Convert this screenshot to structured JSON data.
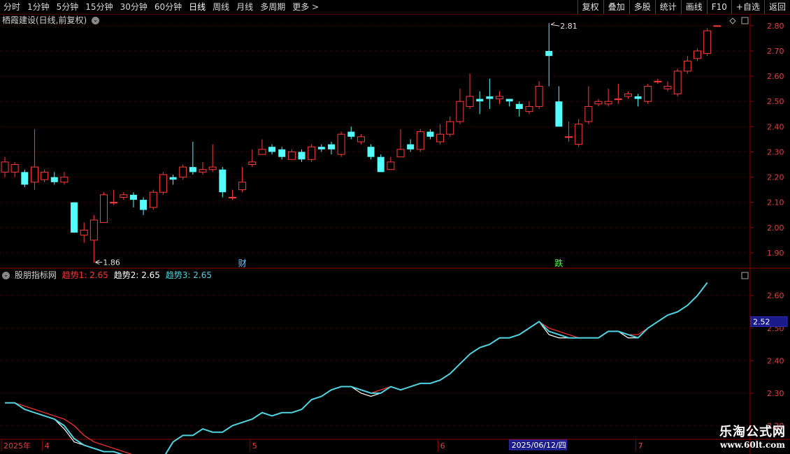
{
  "toolbar": {
    "periods": [
      "分时",
      "1分钟",
      "5分钟",
      "15分钟",
      "30分钟",
      "60分钟",
      "日线",
      "周线",
      "月线",
      "多周期",
      "更多 >"
    ],
    "active_period": "日线",
    "buttons": [
      "复权",
      "叠加",
      "多股",
      "统计",
      "画线",
      "F10",
      "+自选",
      "返回"
    ]
  },
  "main_chart": {
    "title": "栖霞建设(日线,前复权)",
    "y_ticks": [
      "2.80",
      "2.70",
      "2.60",
      "2.50",
      "2.40",
      "2.30",
      "2.20",
      "2.10",
      "2.00",
      "1.90"
    ],
    "high_label": "2.81",
    "low_label": "1.86",
    "markers": [
      {
        "text": "财",
        "color": "#6ec6ff"
      },
      {
        "text": "跌",
        "color": "#4cff4c"
      }
    ]
  },
  "indicator": {
    "name": "股朋指标网",
    "lines": [
      {
        "label": "趋势1: 2.65",
        "color": "#ff3333"
      },
      {
        "label": "趋势2: 2.65",
        "color": "#ffffff"
      },
      {
        "label": "趋势3: 2.65",
        "color": "#4fd3e0"
      }
    ],
    "y_ticks": [
      "2.60",
      "2.50",
      "2.40",
      "2.30",
      "2.20"
    ],
    "cursor_value": "2.52"
  },
  "x_axis": {
    "labels": [
      "2025年",
      "4",
      "5",
      "6",
      "7"
    ],
    "cursor_date": "2025/06/12/四"
  },
  "watermark": {
    "line1": "乐淘公式网",
    "line2": "www.60lt.com"
  },
  "chart_data": {
    "type": "candlestick",
    "candles": [
      [
        2.22,
        2.26,
        2.2,
        2.28
      ],
      [
        2.22,
        2.25,
        2.2,
        2.26
      ],
      [
        2.22,
        2.17,
        2.16,
        2.23
      ],
      [
        2.18,
        2.24,
        2.15,
        2.39
      ],
      [
        2.19,
        2.22,
        2.18,
        2.23
      ],
      [
        2.2,
        2.18,
        2.17,
        2.22
      ],
      [
        2.18,
        2.2,
        2.17,
        2.22
      ],
      [
        2.1,
        1.98,
        1.98,
        2.1
      ],
      [
        1.97,
        1.99,
        1.94,
        2.02
      ],
      [
        1.95,
        2.03,
        1.86,
        2.05
      ],
      [
        2.02,
        2.13,
        2.02,
        2.14
      ],
      [
        2.1,
        2.1,
        2.09,
        2.15
      ],
      [
        2.12,
        2.13,
        2.11,
        2.14
      ],
      [
        2.13,
        2.11,
        2.08,
        2.14
      ],
      [
        2.11,
        2.07,
        2.05,
        2.12
      ],
      [
        2.08,
        2.14,
        2.07,
        2.15
      ],
      [
        2.14,
        2.21,
        2.13,
        2.22
      ],
      [
        2.2,
        2.19,
        2.17,
        2.21
      ],
      [
        2.2,
        2.24,
        2.19,
        2.25
      ],
      [
        2.24,
        2.22,
        2.21,
        2.34
      ],
      [
        2.22,
        2.23,
        2.21,
        2.26
      ],
      [
        2.23,
        2.24,
        2.22,
        2.33
      ],
      [
        2.23,
        2.14,
        2.12,
        2.24
      ],
      [
        2.12,
        2.12,
        2.11,
        2.15
      ],
      [
        2.15,
        2.18,
        2.14,
        2.24
      ],
      [
        2.25,
        2.26,
        2.24,
        2.31
      ],
      [
        2.29,
        2.31,
        2.29,
        2.35
      ],
      [
        2.32,
        2.3,
        2.29,
        2.33
      ],
      [
        2.31,
        2.28,
        2.27,
        2.32
      ],
      [
        2.27,
        2.3,
        2.27,
        2.31
      ],
      [
        2.3,
        2.27,
        2.26,
        2.31
      ],
      [
        2.27,
        2.32,
        2.26,
        2.33
      ],
      [
        2.32,
        2.31,
        2.3,
        2.33
      ],
      [
        2.33,
        2.31,
        2.29,
        2.34
      ],
      [
        2.29,
        2.37,
        2.28,
        2.38
      ],
      [
        2.38,
        2.36,
        2.35,
        2.4
      ],
      [
        2.34,
        2.36,
        2.33,
        2.37
      ],
      [
        2.32,
        2.28,
        2.27,
        2.33
      ],
      [
        2.28,
        2.22,
        2.22,
        2.29
      ],
      [
        2.23,
        2.26,
        2.23,
        2.28
      ],
      [
        2.28,
        2.31,
        2.28,
        2.39
      ],
      [
        2.33,
        2.31,
        2.3,
        2.35
      ],
      [
        2.31,
        2.38,
        2.3,
        2.39
      ],
      [
        2.38,
        2.36,
        2.35,
        2.39
      ],
      [
        2.34,
        2.37,
        2.33,
        2.41
      ],
      [
        2.37,
        2.42,
        2.36,
        2.44
      ],
      [
        2.42,
        2.5,
        2.41,
        2.55
      ],
      [
        2.48,
        2.52,
        2.47,
        2.61
      ],
      [
        2.51,
        2.5,
        2.45,
        2.54
      ],
      [
        2.52,
        2.51,
        2.47,
        2.59
      ],
      [
        2.51,
        2.52,
        2.49,
        2.54
      ],
      [
        2.51,
        2.5,
        2.48,
        2.51
      ],
      [
        2.49,
        2.47,
        2.44,
        2.5
      ],
      [
        2.46,
        2.48,
        2.45,
        2.5
      ],
      [
        2.48,
        2.56,
        2.47,
        2.58
      ],
      [
        2.7,
        2.68,
        2.56,
        2.81
      ],
      [
        2.5,
        2.4,
        2.4,
        2.56
      ],
      [
        2.36,
        2.36,
        2.34,
        2.42
      ],
      [
        2.33,
        2.41,
        2.32,
        2.43
      ],
      [
        2.42,
        2.48,
        2.41,
        2.56
      ],
      [
        2.49,
        2.5,
        2.48,
        2.51
      ],
      [
        2.49,
        2.5,
        2.48,
        2.55
      ],
      [
        2.51,
        2.51,
        2.49,
        2.57
      ],
      [
        2.52,
        2.53,
        2.51,
        2.54
      ],
      [
        2.52,
        2.51,
        2.48,
        2.53
      ],
      [
        2.5,
        2.56,
        2.49,
        2.57
      ],
      [
        2.58,
        2.58,
        2.57,
        2.59
      ],
      [
        2.55,
        2.56,
        2.54,
        2.58
      ],
      [
        2.53,
        2.62,
        2.52,
        2.63
      ],
      [
        2.62,
        2.66,
        2.61,
        2.68
      ],
      [
        2.67,
        2.7,
        2.66,
        2.71
      ],
      [
        2.69,
        2.78,
        2.68,
        2.79
      ],
      [
        2.8,
        2.8,
        2.8,
        2.8
      ]
    ],
    "trend_series": [
      {
        "name": "趋势1",
        "values": [
          2.27,
          2.27,
          2.26,
          2.25,
          2.24,
          2.23,
          2.22,
          2.2,
          2.17,
          2.15,
          2.14,
          2.13,
          2.12,
          2.11,
          2.09,
          2.09,
          2.1,
          2.15,
          2.17,
          2.17,
          2.19,
          2.18,
          2.18,
          2.2,
          2.21,
          2.22,
          2.24,
          2.23,
          2.24,
          2.24,
          2.25,
          2.28,
          2.29,
          2.31,
          2.32,
          2.32,
          2.31,
          2.3,
          2.31,
          2.32,
          2.31,
          2.32,
          2.33,
          2.33,
          2.34,
          2.36,
          2.39,
          2.42,
          2.44,
          2.45,
          2.47,
          2.47,
          2.48,
          2.5,
          2.52,
          2.5,
          2.49,
          2.48,
          2.47,
          2.47,
          2.47,
          2.49,
          2.49,
          2.48,
          2.48,
          2.5,
          2.52,
          2.54,
          2.55,
          2.57,
          2.6,
          2.64
        ]
      },
      {
        "name": "趋势2",
        "values": [
          2.27,
          2.27,
          2.25,
          2.24,
          2.23,
          2.22,
          2.19,
          2.15,
          2.14,
          2.13,
          2.12,
          2.12,
          2.11,
          2.1,
          2.09,
          2.09,
          2.1,
          2.15,
          2.17,
          2.17,
          2.19,
          2.18,
          2.18,
          2.2,
          2.21,
          2.22,
          2.24,
          2.23,
          2.24,
          2.24,
          2.25,
          2.28,
          2.29,
          2.31,
          2.32,
          2.32,
          2.3,
          2.29,
          2.3,
          2.32,
          2.31,
          2.32,
          2.33,
          2.33,
          2.34,
          2.36,
          2.39,
          2.42,
          2.44,
          2.45,
          2.47,
          2.47,
          2.48,
          2.5,
          2.52,
          2.48,
          2.47,
          2.47,
          2.47,
          2.47,
          2.47,
          2.49,
          2.49,
          2.47,
          2.47,
          2.5,
          2.52,
          2.54,
          2.55,
          2.57,
          2.6,
          2.64
        ]
      },
      {
        "name": "趋势3",
        "values": [
          2.27,
          2.27,
          2.25,
          2.24,
          2.23,
          2.22,
          2.2,
          2.16,
          2.14,
          2.13,
          2.12,
          2.12,
          2.11,
          2.1,
          2.09,
          2.09,
          2.1,
          2.15,
          2.17,
          2.17,
          2.19,
          2.18,
          2.18,
          2.2,
          2.21,
          2.22,
          2.24,
          2.23,
          2.24,
          2.24,
          2.25,
          2.28,
          2.29,
          2.31,
          2.32,
          2.32,
          2.31,
          2.3,
          2.3,
          2.32,
          2.31,
          2.32,
          2.33,
          2.33,
          2.34,
          2.36,
          2.39,
          2.42,
          2.44,
          2.45,
          2.47,
          2.47,
          2.48,
          2.5,
          2.52,
          2.49,
          2.48,
          2.47,
          2.47,
          2.47,
          2.47,
          2.49,
          2.49,
          2.48,
          2.47,
          2.5,
          2.52,
          2.54,
          2.55,
          2.57,
          2.6,
          2.64
        ]
      }
    ],
    "ylim_main": [
      1.85,
      2.83
    ],
    "ylim_indicator": [
      2.16,
      2.68
    ]
  }
}
